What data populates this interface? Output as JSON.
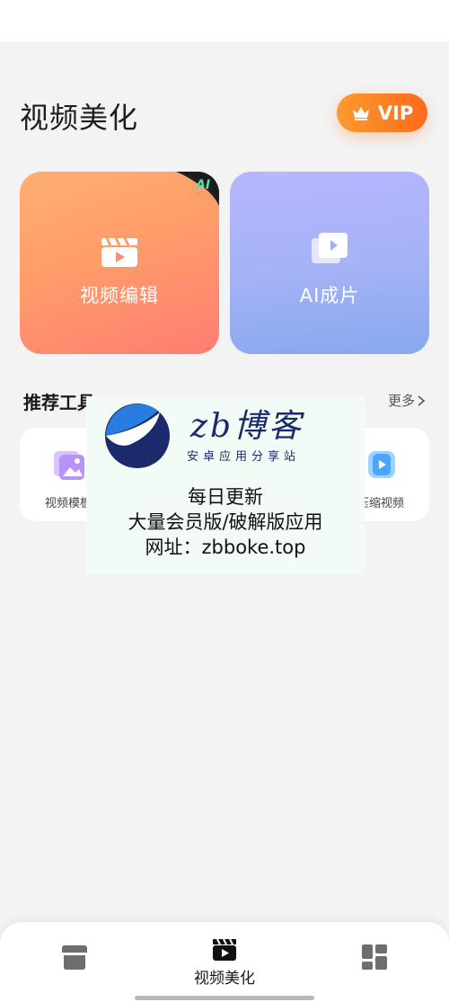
{
  "header": {
    "title": "视频美化",
    "vip_label": "VIP"
  },
  "cards": [
    {
      "label": "视频编辑",
      "badge": "AI",
      "icon": "clapperboard-icon"
    },
    {
      "label": "AI成片",
      "icon": "stacked-video-icon"
    }
  ],
  "tools_section": {
    "title": "推荐工具",
    "more_label": "更多"
  },
  "tools": [
    {
      "label": "视频模板",
      "icon": "template-image-icon"
    },
    {
      "label": "压缩视频",
      "icon": "compress-video-icon"
    }
  ],
  "watermark": {
    "brand": "zb博客",
    "subtitle": "安卓应用分享站",
    "line1": "每日更新",
    "line2": "大量会员版/破解版应用",
    "line3": "网址：zbboke.top"
  },
  "bottom_nav": {
    "items": [
      {
        "label": "",
        "icon": "store-icon"
      },
      {
        "label": "视频美化",
        "icon": "clapperboard-icon",
        "active": true
      },
      {
        "label": "",
        "icon": "grid-icon"
      }
    ]
  },
  "colors": {
    "vip_gradient": [
      "#ff9a2e",
      "#ff6a1a"
    ],
    "card_edit": "#ff9c6a",
    "card_ai": "#a6b3f6",
    "background": "#f3f3f3"
  }
}
